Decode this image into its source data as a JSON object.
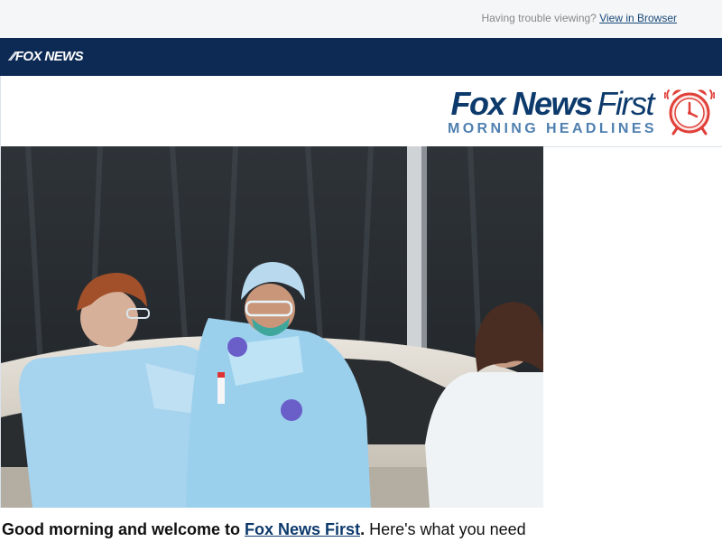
{
  "header": {
    "trouble_text": "Having trouble viewing?",
    "view_link": "View in Browser"
  },
  "nav": {
    "logo_text": "FOX NEWS"
  },
  "masthead": {
    "title_bold": "Fox News",
    "title_light": "First",
    "subtitle": "MORNING HEADLINES",
    "icon": "alarm-clock-icon"
  },
  "hero": {
    "icon": "hero-photo"
  },
  "intro": {
    "greeting": "Good morning and welcome to",
    "link": "Fox News First",
    "rest": "Here's what you need"
  },
  "colors": {
    "navy": "#0d2a55",
    "title_blue": "#0d3a6c",
    "subtitle_blue": "#4f7fb0",
    "clock_red": "#e0403a"
  }
}
